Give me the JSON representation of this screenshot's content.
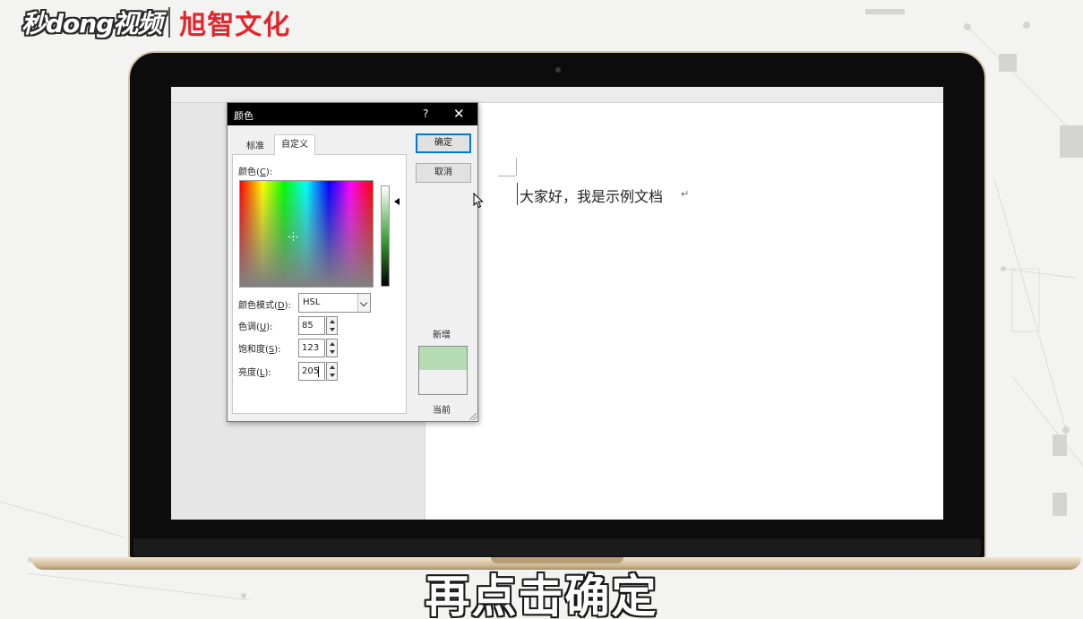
{
  "logo": {
    "brand": "秒dong视频",
    "partner": "旭智文化"
  },
  "document": {
    "text": "大家好，我是示例文档",
    "paragraph_mark": "↵"
  },
  "dialog": {
    "title": "颜色",
    "help_label": "?",
    "close_label": "✕",
    "tabs": [
      {
        "label": "标准",
        "active": false
      },
      {
        "label": "自定义",
        "active": true
      }
    ],
    "colors_label": "颜色(",
    "colors_key": "C",
    "colors_suffix": "):",
    "color_mode_label": "颜色模式(",
    "color_mode_key": "D",
    "color_mode_suffix": "):",
    "color_mode_value": "HSL",
    "hue_label": "色调(",
    "hue_key": "U",
    "hue_suffix": "):",
    "hue_value": "85",
    "saturation_label": "饱和度(",
    "saturation_key": "S",
    "saturation_suffix": "):",
    "saturation_value": "123",
    "luminance_label": "亮度(",
    "luminance_key": "L",
    "luminance_suffix": "):",
    "luminance_value": "205",
    "ok_label": "确定",
    "cancel_label": "取消",
    "new_label": "新增",
    "current_label": "当前",
    "new_color": "#b6dcb3",
    "current_color": "#f0f0f0"
  },
  "subtitle": "再点击确定",
  "colors": {
    "accent": "#0078d7",
    "titlebar": "#000000",
    "partner_red": "#e3262b"
  }
}
